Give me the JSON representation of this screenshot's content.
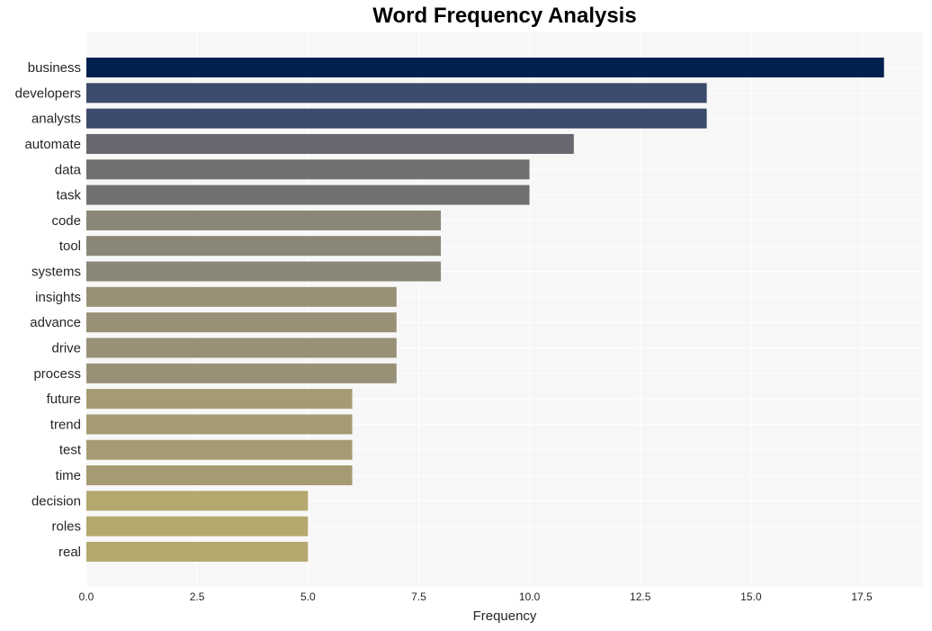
{
  "chart_data": {
    "type": "bar",
    "orientation": "horizontal",
    "title": "Word Frequency Analysis",
    "xlabel": "Frequency",
    "ylabel": "",
    "xlim": [
      0,
      18.9
    ],
    "xticks": [
      0.0,
      2.5,
      5.0,
      7.5,
      10.0,
      12.5,
      15.0,
      17.5
    ],
    "xtick_labels": [
      "0.0",
      "2.5",
      "5.0",
      "7.5",
      "10.0",
      "12.5",
      "15.0",
      "17.5"
    ],
    "grid": true,
    "categories": [
      "business",
      "developers",
      "analysts",
      "automate",
      "data",
      "task",
      "code",
      "tool",
      "systems",
      "insights",
      "advance",
      "drive",
      "process",
      "future",
      "trend",
      "test",
      "time",
      "decision",
      "roles",
      "real"
    ],
    "values": [
      18,
      14,
      14,
      11,
      10,
      10,
      8,
      8,
      8,
      7,
      7,
      7,
      7,
      6,
      6,
      6,
      6,
      5,
      5,
      5
    ],
    "colors": [
      "#00204e",
      "#3c4a6b",
      "#3c4a6b",
      "#67686f",
      "#707070",
      "#707070",
      "#8a8778",
      "#8a8778",
      "#8a8778",
      "#989177",
      "#989177",
      "#989177",
      "#989177",
      "#a59b72",
      "#a59b72",
      "#a59b72",
      "#a59b72",
      "#b4a86e",
      "#b4a86e",
      "#b4a86e"
    ],
    "plot_background": "#f7f7f7",
    "grid_color": "#ffffff"
  }
}
